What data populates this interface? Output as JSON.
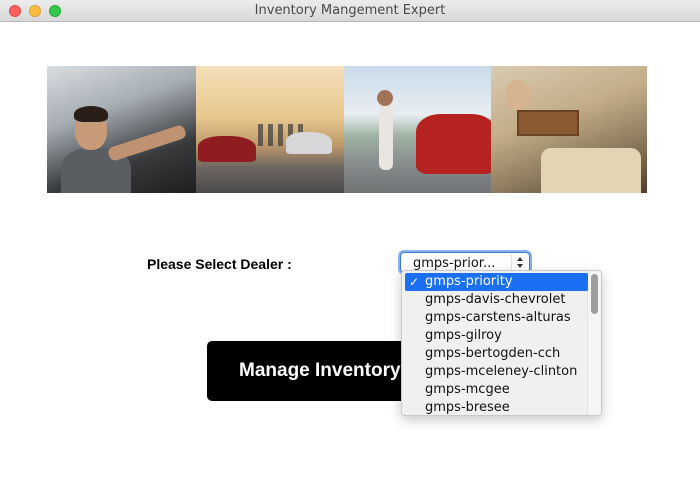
{
  "window": {
    "title": "Inventory Mangement Expert"
  },
  "banner": {
    "photos": [
      "driver-in-car-photo",
      "beach-cars-photo",
      "woman-red-car-photo",
      "trunk-produce-photo"
    ]
  },
  "form": {
    "dealer_label": "Please Select Dealer :",
    "select_value": "gmps-prior...",
    "options": [
      "gmps-priority",
      "gmps-davis-chevrolet",
      "gmps-carstens-alturas",
      "gmps-gilroy",
      "gmps-bertogden-cch",
      "gmps-mceleney-clinton",
      "gmps-mcgee",
      "gmps-bresee"
    ],
    "selected_index": 0,
    "check_glyph": "✓"
  },
  "actions": {
    "manage_label": "Manage Inventory"
  },
  "colors": {
    "accent": "#1a6ff2",
    "button_bg": "#000000"
  }
}
